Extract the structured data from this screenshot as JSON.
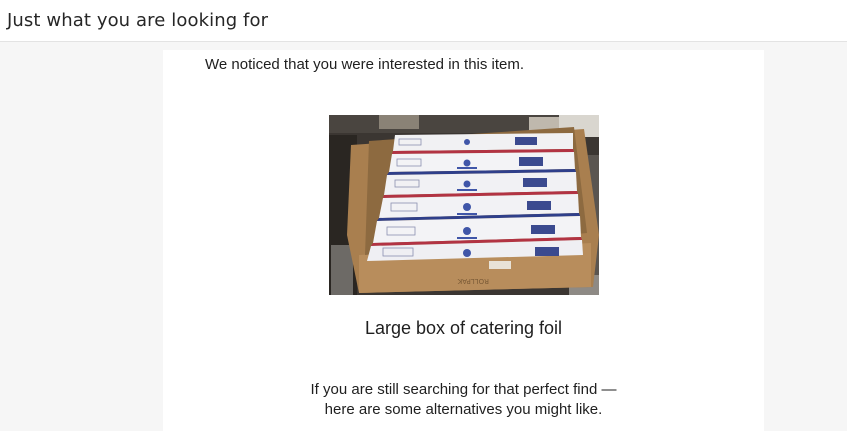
{
  "header": {
    "title": "Just what you are looking for"
  },
  "email": {
    "intro_text": "We noticed that you were interested in this item.",
    "product": {
      "name": "Large box of catering foil",
      "image_alt": "Large box of catering foil"
    },
    "closing_line_1": "If you are still searching for that perfect find —",
    "closing_line_2": "here are some alternatives you might like."
  },
  "colors": {
    "page_background": "#f6f6f6",
    "text": "#1f1f1f",
    "header_text": "#262626"
  }
}
